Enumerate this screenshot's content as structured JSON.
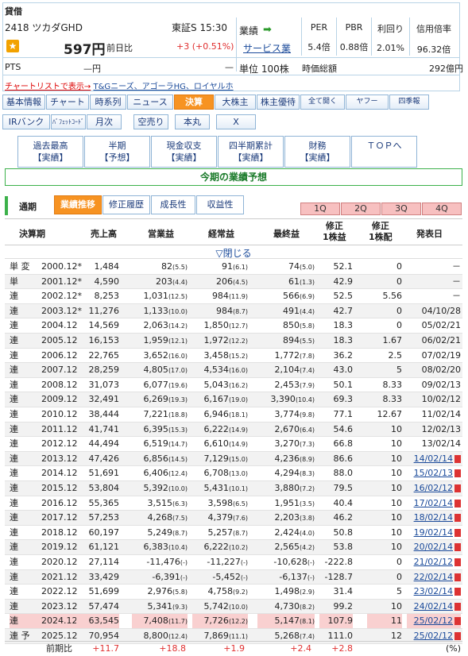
{
  "header": {
    "tag": "貸借",
    "code": "2418",
    "name": "ツカダGHD",
    "market": "東証S",
    "time": "15:30",
    "price": "597円",
    "prev_label": "前日比",
    "change": "+3",
    "change_pct": "(+0.51%)",
    "pts_label": "PTS",
    "pts_value": "—円",
    "pts_change": "—",
    "gyoseki_label": "業績",
    "service": "サービス業",
    "unit": "単位 100株",
    "ratios": [
      {
        "h": "PER",
        "v": "5.4倍"
      },
      {
        "h": "PBR",
        "v": "0.88倍"
      },
      {
        "h": "利回り",
        "v": "2.01%"
      },
      {
        "h": "信用倍率",
        "v": "96.32倍"
      }
    ],
    "market_cap_label": "時価総額",
    "market_cap": "292億円",
    "chart_link": "チャートリストで表示→",
    "related": "T&Gニーズ、アゴーラHG、ロイヤルホ"
  },
  "tabs_row1": [
    "基本情報",
    "チャート",
    "時系列",
    "ニュース",
    "決算",
    "大株主",
    "株主優待",
    "全て開く",
    "ヤフー",
    "四季報"
  ],
  "tabs_row2": [
    "IRバンク",
    "ﾊﾞﾌｪｯﾄｺｰﾄﾞ",
    "月次",
    "空売り",
    "本丸",
    "X"
  ],
  "subtabs": [
    {
      "l1": "過去最高",
      "l2": "【実績】"
    },
    {
      "l1": "半期",
      "l2": "【予想】"
    },
    {
      "l1": "現金収支",
      "l2": "【実績】"
    },
    {
      "l1": "四半期累計",
      "l2": "【実績】"
    },
    {
      "l1": "財務",
      "l2": "【実績】"
    },
    {
      "l1": "ＴＯＰへ",
      "l2": ""
    }
  ],
  "section_title": "今期の業績予想",
  "period_label": "通期",
  "data_tabs": [
    "業績推移",
    "修正履歴",
    "成長性",
    "収益性"
  ],
  "quarter_tabs": [
    "1Q",
    "2Q",
    "3Q",
    "4Q"
  ],
  "columns": [
    "決算期",
    "売上高",
    "営業益",
    "経常益",
    "最終益",
    "修正\n1株益",
    "修正\n1株配",
    "発表日"
  ],
  "toggle": "▽閉じる",
  "rows": [
    [
      "単 変",
      "2000.12*",
      "1,484",
      "82",
      "(5.5)",
      "91",
      "(6.1)",
      "74",
      "(5.0)",
      "52.1",
      "0",
      "－"
    ],
    [
      "単",
      "2001.12*",
      "4,590",
      "203",
      "(4.4)",
      "206",
      "(4.5)",
      "61",
      "(1.3)",
      "42.9",
      "0",
      "－"
    ],
    [
      "連",
      "2002.12*",
      "8,253",
      "1,031",
      "(12.5)",
      "984",
      "(11.9)",
      "566",
      "(6.9)",
      "52.5",
      "5.56",
      "－"
    ],
    [
      "連",
      "2003.12*",
      "11,276",
      "1,133",
      "(10.0)",
      "984",
      "(8.7)",
      "491",
      "(4.4)",
      "42.7",
      "0",
      "04/10/28"
    ],
    [
      "連",
      "2004.12",
      "14,569",
      "2,063",
      "(14.2)",
      "1,850",
      "(12.7)",
      "850",
      "(5.8)",
      "18.3",
      "0",
      "05/02/21"
    ],
    [
      "連",
      "2005.12",
      "16,153",
      "1,959",
      "(12.1)",
      "1,972",
      "(12.2)",
      "894",
      "(5.5)",
      "18.3",
      "1.67",
      "06/02/21"
    ],
    [
      "連",
      "2006.12",
      "22,765",
      "3,652",
      "(16.0)",
      "3,458",
      "(15.2)",
      "1,772",
      "(7.8)",
      "36.2",
      "2.5",
      "07/02/19"
    ],
    [
      "連",
      "2007.12",
      "28,259",
      "4,805",
      "(17.0)",
      "4,534",
      "(16.0)",
      "2,104",
      "(7.4)",
      "43.0",
      "5",
      "08/02/20"
    ],
    [
      "連",
      "2008.12",
      "31,073",
      "6,077",
      "(19.6)",
      "5,043",
      "(16.2)",
      "2,453",
      "(7.9)",
      "50.1",
      "8.33",
      "09/02/13"
    ],
    [
      "連",
      "2009.12",
      "32,491",
      "6,269",
      "(19.3)",
      "6,167",
      "(19.0)",
      "3,390",
      "(10.4)",
      "69.3",
      "8.33",
      "10/02/12"
    ],
    [
      "連",
      "2010.12",
      "38,444",
      "7,221",
      "(18.8)",
      "6,946",
      "(18.1)",
      "3,774",
      "(9.8)",
      "77.1",
      "12.67",
      "11/02/14"
    ],
    [
      "連",
      "2011.12",
      "41,741",
      "6,395",
      "(15.3)",
      "6,222",
      "(14.9)",
      "2,670",
      "(6.4)",
      "54.6",
      "10",
      "12/02/13"
    ],
    [
      "連",
      "2012.12",
      "44,494",
      "6,519",
      "(14.7)",
      "6,610",
      "(14.9)",
      "3,270",
      "(7.3)",
      "66.8",
      "10",
      "13/02/14"
    ],
    [
      "連",
      "2013.12",
      "47,426",
      "6,856",
      "(14.5)",
      "7,129",
      "(15.0)",
      "4,236",
      "(8.9)",
      "86.6",
      "10",
      "14/02/14"
    ],
    [
      "連",
      "2014.12",
      "51,691",
      "6,406",
      "(12.4)",
      "6,708",
      "(13.0)",
      "4,294",
      "(8.3)",
      "88.0",
      "10",
      "15/02/13"
    ],
    [
      "連",
      "2015.12",
      "53,804",
      "5,392",
      "(10.0)",
      "5,431",
      "(10.1)",
      "3,880",
      "(7.2)",
      "79.5",
      "10",
      "16/02/12"
    ],
    [
      "連",
      "2016.12",
      "55,365",
      "3,515",
      "(6.3)",
      "3,598",
      "(6.5)",
      "1,951",
      "(3.5)",
      "40.4",
      "10",
      "17/02/14"
    ],
    [
      "連",
      "2017.12",
      "57,253",
      "4,268",
      "(7.5)",
      "4,379",
      "(7.6)",
      "2,203",
      "(3.8)",
      "46.2",
      "10",
      "18/02/14"
    ],
    [
      "連",
      "2018.12",
      "60,197",
      "5,249",
      "(8.7)",
      "5,257",
      "(8.7)",
      "2,424",
      "(4.0)",
      "50.8",
      "10",
      "19/02/14"
    ],
    [
      "連",
      "2019.12",
      "61,121",
      "6,383",
      "(10.4)",
      "6,222",
      "(10.2)",
      "2,565",
      "(4.2)",
      "53.8",
      "10",
      "20/02/14"
    ],
    [
      "連",
      "2020.12",
      "27,114",
      "-11,476",
      "(-)",
      "-11,227",
      "(-)",
      "-10,628",
      "(-)",
      "-222.8",
      "0",
      "21/02/12"
    ],
    [
      "連",
      "2021.12",
      "33,429",
      "-6,391",
      "(-)",
      "-5,452",
      "(-)",
      "-6,137",
      "(-)",
      "-128.7",
      "0",
      "22/02/14"
    ],
    [
      "連",
      "2022.12",
      "51,699",
      "2,976",
      "(5.8)",
      "4,758",
      "(9.2)",
      "1,498",
      "(2.9)",
      "31.4",
      "5",
      "23/02/14"
    ],
    [
      "連",
      "2023.12",
      "57,474",
      "5,341",
      "(9.3)",
      "5,742",
      "(10.0)",
      "4,730",
      "(8.2)",
      "99.2",
      "10",
      "24/02/14"
    ],
    [
      "連",
      "2024.12",
      "63,545",
      "7,408",
      "(11.7)",
      "7,726",
      "(12.2)",
      "5,147",
      "(8.1)",
      "107.9",
      "11",
      "25/02/12"
    ],
    [
      "連 予",
      "2025.12",
      "70,954",
      "8,800",
      "(12.4)",
      "7,869",
      "(11.1)",
      "5,268",
      "(7.4)",
      "111.0",
      "12",
      "25/02/12"
    ]
  ],
  "footer": {
    "label": "前期比",
    "sales": "+11.7",
    "op": "+18.8",
    "ord": "+1.9",
    "net": "+2.4",
    "eps": "+2.8",
    "unit": "(%)"
  },
  "colors": {
    "accent": "#f79322",
    "green": "#3cb14a",
    "red": "#e03030",
    "highlight": "#f9d0d0"
  }
}
